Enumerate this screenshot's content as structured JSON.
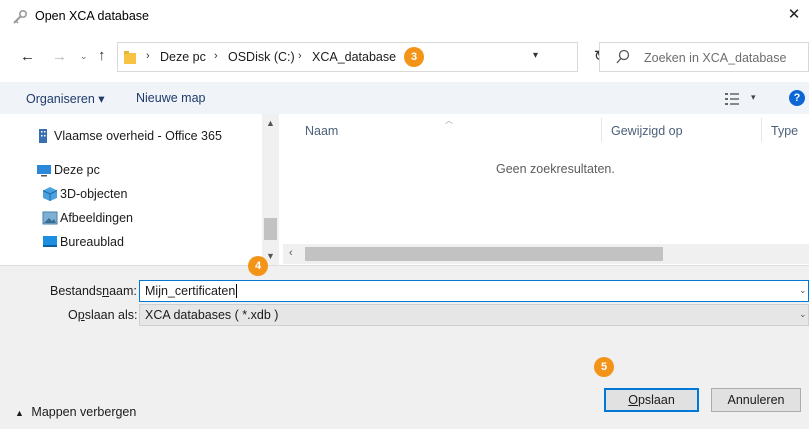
{
  "window": {
    "title": "Open XCA database",
    "close_glyph": "✕"
  },
  "nav_buttons": {
    "back": "←",
    "forward": "→",
    "recent": "⌄",
    "up": "↑"
  },
  "address": {
    "crumbs": [
      "Deze pc",
      "OSDisk (C:)",
      "XCA_database"
    ],
    "separator": "›",
    "badge": "3"
  },
  "search": {
    "placeholder": "Zoeken in XCA_database"
  },
  "toolbar": {
    "organize_label": "Organiseren ▾",
    "new_folder_label": "Nieuwe map",
    "help_label": "?"
  },
  "nav_pane": {
    "items": [
      {
        "label": "Vlaamse overheid - Office 365",
        "icon": "building-icon"
      },
      {
        "label": "Deze pc",
        "icon": "computer-icon"
      },
      {
        "label": "3D-objecten",
        "icon": "cube-icon"
      },
      {
        "label": "Afbeeldingen",
        "icon": "pictures-icon"
      },
      {
        "label": "Bureaublad",
        "icon": "desktop-icon"
      }
    ]
  },
  "file_list": {
    "columns": [
      "Naam",
      "Gewijzigd op",
      "Type"
    ],
    "empty_message": "Geen zoekresultaten."
  },
  "form": {
    "filename_label": "Bestandsnaam:",
    "filename_label_parts": [
      "Bestands",
      "n",
      "aam:"
    ],
    "filename_value": "Mijn_certificaten",
    "filename_badge": "4",
    "filetype_label": "Opslaan als:",
    "filetype_label_parts": [
      "O",
      "p",
      "slaan als:"
    ],
    "filetype_value": "XCA databases ( *.xdb )"
  },
  "footer": {
    "hide_folders": "Mappen verbergen",
    "save_label": "Opslaan",
    "save_badge": "5",
    "cancel_label": "Annuleren"
  },
  "colors": {
    "accent": "#0078d7",
    "badge": "#f39318",
    "toolbar_bg": "#f0f4f9"
  }
}
